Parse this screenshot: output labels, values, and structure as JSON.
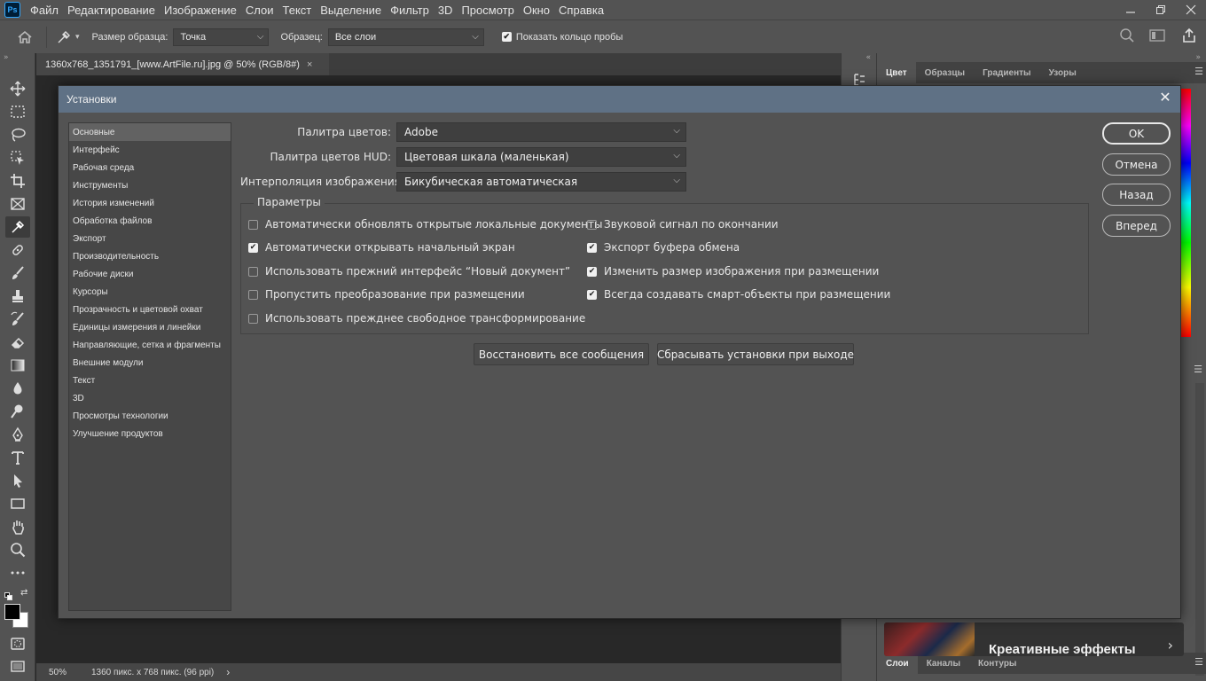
{
  "app": {
    "logo": "Ps"
  },
  "menu": [
    "Файл",
    "Редактирование",
    "Изображение",
    "Слои",
    "Текст",
    "Выделение",
    "Фильтр",
    "3D",
    "Просмотр",
    "Окно",
    "Справка"
  ],
  "options": {
    "sample_size_label": "Размер образца:",
    "sample_size_value": "Точка",
    "sample_label": "Образец:",
    "sample_value": "Все слои",
    "show_ring_label": "Показать кольцо пробы",
    "show_ring_checked": true
  },
  "document": {
    "tab_title": "1360x768_1351791_[www.ArtFile.ru].jpg @ 50% (RGB/8#)",
    "tab_close": "×",
    "zoom": "50%",
    "size_info": "1360 пикс. x 768 пикс. (96 ppi)",
    "status_arrow": "›"
  },
  "panels": {
    "top_tabs": [
      "Цвет",
      "Образцы",
      "Градиенты",
      "Узоры"
    ],
    "bottom_tabs": [
      "Слои",
      "Каналы",
      "Контуры"
    ],
    "learn_card_title": "Креативные эффекты",
    "learn_card_chevron": "›"
  },
  "dialog": {
    "title": "Установки",
    "close_glyph": "✕",
    "categories": [
      "Основные",
      "Интерфейс",
      "Рабочая среда",
      "Инструменты",
      "История изменений",
      "Обработка файлов",
      "Экспорт",
      "Производительность",
      "Рабочие диски",
      "Курсоры",
      "Прозрачность и цветовой охват",
      "Единицы измерения и линейки",
      "Направляющие, сетка и фрагменты",
      "Внешние модули",
      "Текст",
      "3D",
      "Просмотры технологии",
      "Улучшение продуктов"
    ],
    "selected_category": "Основные",
    "fields": {
      "color_picker_label": "Палитра цветов:",
      "color_picker_value": "Adobe",
      "hud_picker_label": "Палитра цветов HUD:",
      "hud_picker_value": "Цветовая шкала (маленькая)",
      "interpolation_label": "Интерполяция изображения:",
      "interpolation_value": "Бикубическая автоматическая"
    },
    "params_legend": "Параметры",
    "params_left": [
      {
        "label": "Автоматически обновлять открытые локальные документы",
        "checked": false
      },
      {
        "label": "Автоматически открывать начальный экран",
        "checked": true
      },
      {
        "label": "Использовать прежний интерфейс “Новый документ”",
        "checked": false
      },
      {
        "label": "Пропустить преобразование при размещении",
        "checked": false
      },
      {
        "label": "Использовать прежднее свободное трансформирование",
        "checked": false
      }
    ],
    "params_right": [
      {
        "label": "Звуковой сигнал по окончании",
        "checked": false
      },
      {
        "label": "Экспорт буфера обмена",
        "checked": true
      },
      {
        "label": "Изменить размер изображения при размещении",
        "checked": true
      },
      {
        "label": "Всегда создавать смарт-объекты при размещении",
        "checked": true
      }
    ],
    "restore_messages_label": "Восстановить все сообщения",
    "reset_on_exit_label": "Сбрасывать установки при выходе",
    "ok_label": "OK",
    "cancel_label": "Отмена",
    "prev_label": "Назад",
    "next_label": "Вперед"
  }
}
